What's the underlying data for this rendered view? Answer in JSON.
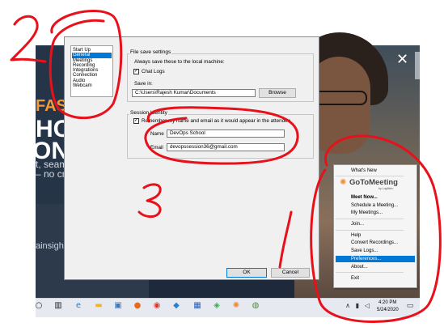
{
  "background_page": {
    "hero_line1": "FAST",
    "hero_line2": "HO",
    "hero_line3": "ONL",
    "sub_line1": "t, seamle",
    "sub_line2": "– no cred",
    "partner": "ainsight",
    "close_glyph": "✕"
  },
  "preferences": {
    "nav_items": [
      {
        "label": "Start Up",
        "selected": false
      },
      {
        "label": "General",
        "selected": true
      },
      {
        "label": "Meetings",
        "selected": false
      },
      {
        "label": "Recording",
        "selected": false
      },
      {
        "label": "Integrations",
        "selected": false
      },
      {
        "label": "Connection",
        "selected": false
      },
      {
        "label": "Audio",
        "selected": false
      },
      {
        "label": "Webcam",
        "selected": false
      }
    ],
    "file_save": {
      "title": "File save settings",
      "description": "Always save these to the local machine:",
      "chat_logs_label": "Chat Logs",
      "chat_logs_checked": true,
      "save_in_label": "Save in:",
      "save_in_value": "C:\\Users\\Rajesh Kumar\\Documents",
      "browse_label": "Browse"
    },
    "session_identity": {
      "title": "Session Identity",
      "remember_label": "Remember my name and email as it would appear in the attendee",
      "remember_checked": true,
      "name_label": "Name",
      "name_value": "DevOps School",
      "email_label": "Email",
      "email_value": "devopssession36@gmail.com"
    },
    "ok_label": "OK",
    "cancel_label": "Cancel"
  },
  "gtm_menu": {
    "whats_new": "What's New",
    "logo_text": "GoToMeeting",
    "logo_sub": "by LogMeIn",
    "logo_icon": "✺",
    "items_group1": [
      "Meet Now...",
      "Schedule a Meeting...",
      "My Meetings..."
    ],
    "join": "Join...",
    "items_group2": [
      "Help",
      "Convert Recordings...",
      "Save Logs...",
      "Preferences...",
      "About..."
    ],
    "highlighted": "Preferences...",
    "exit": "Exit"
  },
  "taskbar": {
    "icons": [
      "search-icon",
      "task-view-icon",
      "edge-icon",
      "file-explorer-icon",
      "store-icon",
      "firefox-icon",
      "chrome-icon",
      "vscode-icon",
      "sourcetree-icon",
      "git-icon",
      "gotomeeting-icon"
    ],
    "time": "4:20 PM",
    "date": "5/24/2020"
  },
  "annotations": {
    "color": "#e8101a",
    "marks": [
      "2",
      "3",
      "1"
    ]
  }
}
